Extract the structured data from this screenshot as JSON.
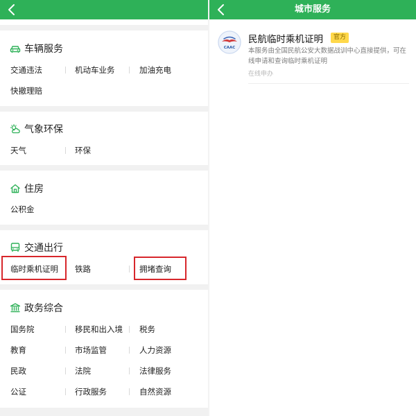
{
  "left_panel": {
    "header": {
      "back_icon": "chevron-left-icon"
    },
    "sections": [
      {
        "title": "车辆服务",
        "icon": "car-icon",
        "items": [
          "交通违法",
          "机动车业务",
          "加油充电",
          "快撤理赔"
        ]
      },
      {
        "title": "气象环保",
        "icon": "weather-icon",
        "items": [
          "天气",
          "环保"
        ]
      },
      {
        "title": "住房",
        "icon": "house-icon",
        "items": [
          "公积金"
        ]
      },
      {
        "title": "交通出行",
        "icon": "bus-icon",
        "items": [
          "临时乘机证明",
          "铁路",
          "拥堵查询"
        ]
      },
      {
        "title": "政务综合",
        "icon": "government-icon",
        "items": [
          "国务院",
          "移民和出入境",
          "税务",
          "教育",
          "市场监管",
          "人力资源",
          "民政",
          "法院",
          "法律服务",
          "公证",
          "行政服务",
          "自然资源"
        ]
      }
    ]
  },
  "right_panel": {
    "header": {
      "title": "城市服务",
      "back_icon": "chevron-left-icon"
    },
    "service": {
      "title": "民航临时乘机证明",
      "badge": "官方",
      "description": "本服务由全国民航公安大数据战训中心直接提供，可在线申请和查询临时乘机证明",
      "meta": "在线申办",
      "logo_text": "CAAC",
      "logo_icon": "caac-logo"
    }
  },
  "colors": {
    "brand_green": "#2eb158",
    "highlight_red": "#d7262b",
    "badge_yellow": "#ffd84a"
  }
}
